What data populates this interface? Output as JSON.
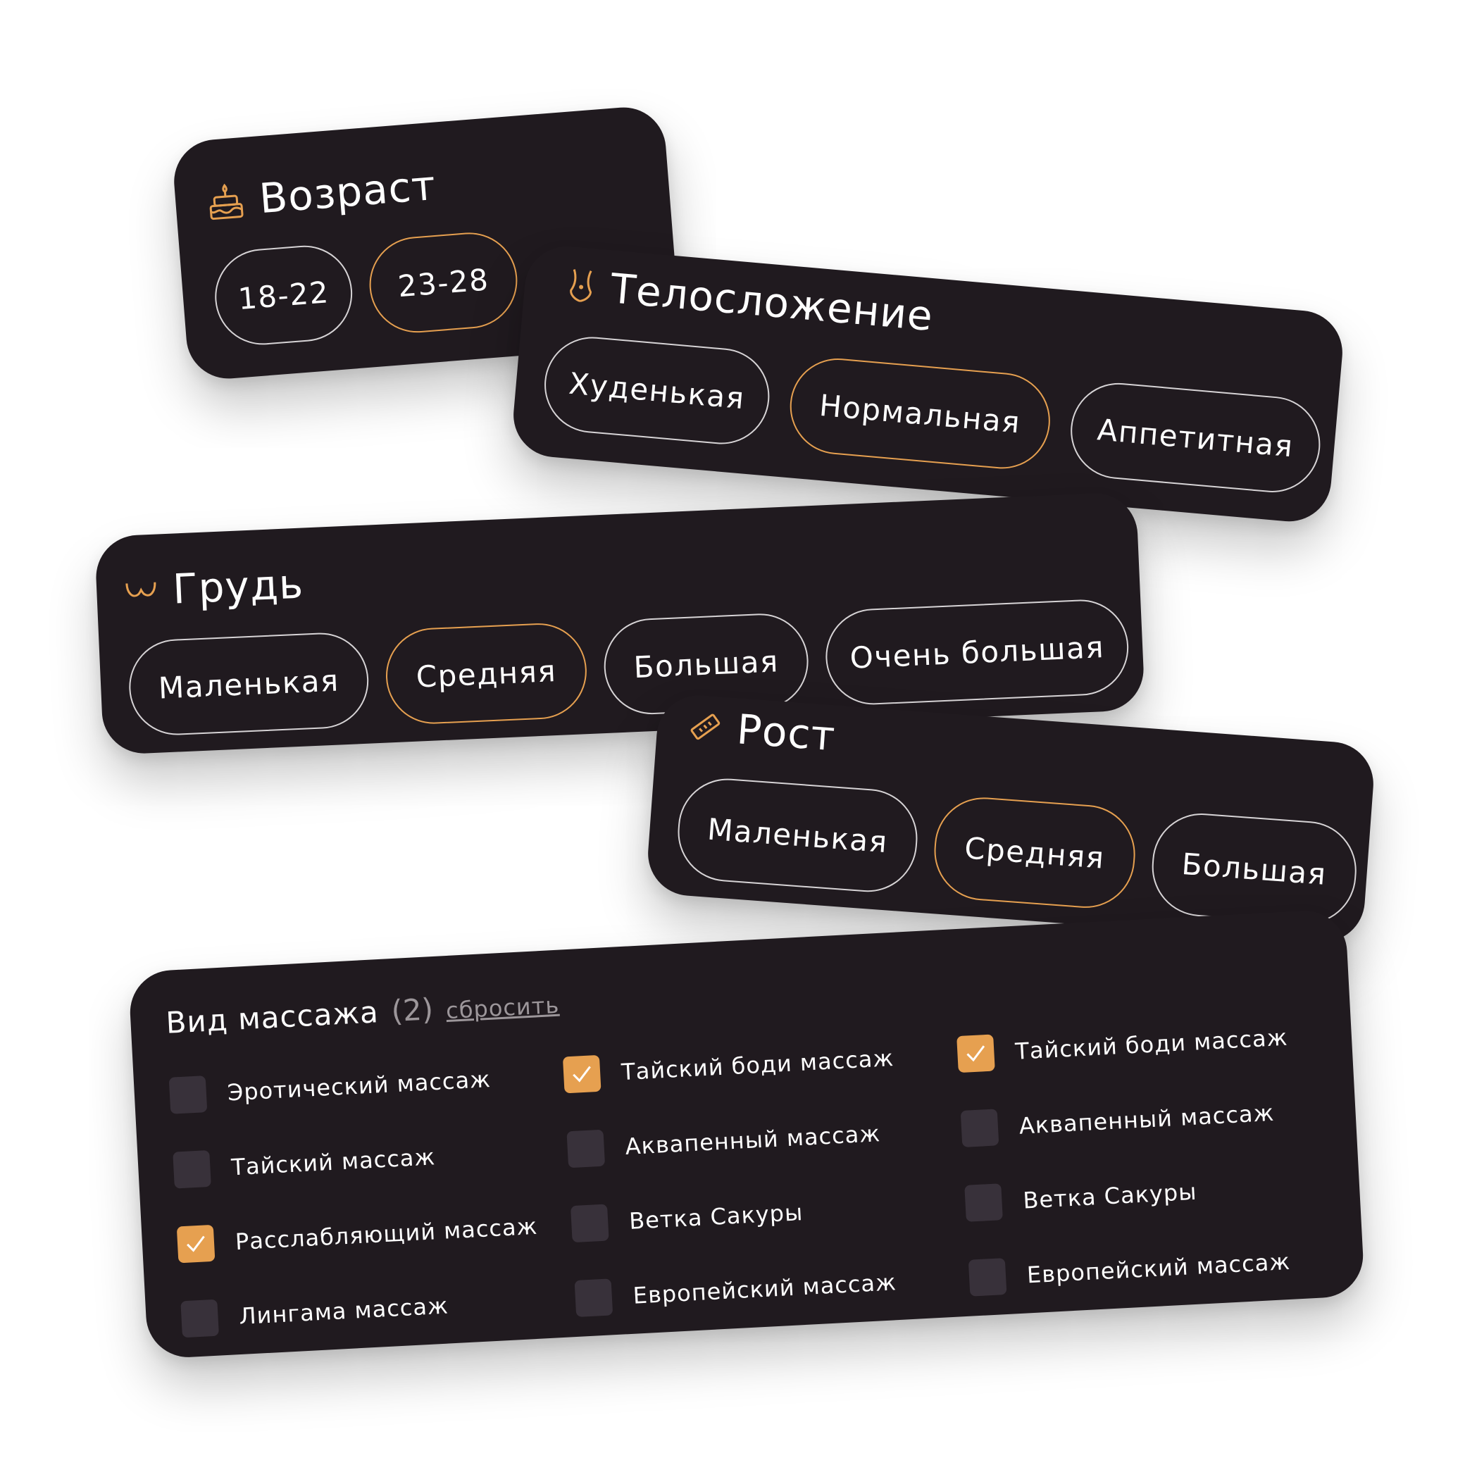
{
  "colors": {
    "card_bg": "#201a1f",
    "accent": "#e6a050",
    "pill_border": "#d7d4d6",
    "muted": "#9c969a",
    "checkbox_bg": "#38313a"
  },
  "age": {
    "title": "Возраст",
    "icon": "cake-icon",
    "options": [
      {
        "label": "18-22",
        "selected": false
      },
      {
        "label": "23-28",
        "selected": true
      }
    ]
  },
  "body_type": {
    "title": "Телосложение",
    "icon": "body-figure-icon",
    "options": [
      {
        "label": "Худенькая",
        "selected": false
      },
      {
        "label": "Нормальная",
        "selected": true
      },
      {
        "label": "Аппетитная",
        "selected": false
      }
    ]
  },
  "breast": {
    "title": "Грудь",
    "icon": "breast-icon",
    "options": [
      {
        "label": "Маленькая",
        "selected": false
      },
      {
        "label": "Средняя",
        "selected": true
      },
      {
        "label": "Большая",
        "selected": false
      },
      {
        "label": "Очень большая",
        "selected": false
      }
    ]
  },
  "height": {
    "title": "Рост",
    "icon": "ruler-icon",
    "options": [
      {
        "label": "Маленькая",
        "selected": false
      },
      {
        "label": "Средняя",
        "selected": true
      },
      {
        "label": "Большая",
        "selected": false
      }
    ]
  },
  "massage": {
    "title": "Вид массажа",
    "count": "(2)",
    "reset_label": "сбросить",
    "columns": [
      [
        {
          "label": "Эротический массаж",
          "checked": false
        },
        {
          "label": "Тайский массаж",
          "checked": false
        },
        {
          "label": "Расслабляющий массаж",
          "checked": true
        },
        {
          "label": "Лингама массаж",
          "checked": false
        }
      ],
      [
        {
          "label": "Тайский боди массаж",
          "checked": true
        },
        {
          "label": "Аквапенный массаж",
          "checked": false
        },
        {
          "label": "Ветка Сакуры",
          "checked": false
        },
        {
          "label": "Европейский массаж",
          "checked": false
        }
      ],
      [
        {
          "label": "Тайский боди массаж",
          "checked": true
        },
        {
          "label": "Аквапенный массаж",
          "checked": false
        },
        {
          "label": "Ветка Сакуры",
          "checked": false
        },
        {
          "label": "Европейский массаж",
          "checked": false
        }
      ]
    ]
  }
}
